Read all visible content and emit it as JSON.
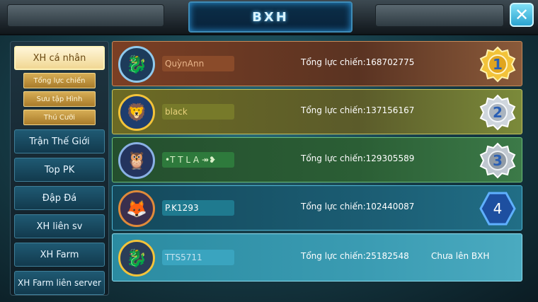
{
  "header": {
    "title": "BXH"
  },
  "sidebar": {
    "tabs": [
      {
        "label": "XH cá nhân",
        "active": true
      },
      {
        "label": "Trận Thế Giới"
      },
      {
        "label": "Top PK"
      },
      {
        "label": "Đập Đá"
      },
      {
        "label": "XH liên sv"
      },
      {
        "label": "XH Farm"
      },
      {
        "label": "XH Farm liên server"
      }
    ],
    "subtabs": [
      {
        "label": "Tổng lực chiến"
      },
      {
        "label": "Sưu tập Hình"
      },
      {
        "label": "Thú Cưỡi"
      }
    ]
  },
  "ranking": {
    "rows": [
      {
        "rank": "1",
        "name": "QuỳnAnn",
        "power": "Tổng lực chiến:168702775",
        "color": "#8a4b2a",
        "badge": "gold-medal-icon"
      },
      {
        "rank": "2",
        "name": "black",
        "power": "Tổng lực chiến:137156167",
        "color": "#6e6a1f",
        "badge": "silver-medal-icon"
      },
      {
        "rank": "3",
        "name": "•T T L A ↠❥",
        "power": "Tổng lực chiến:129305589",
        "color": "#2f6b3a",
        "badge": "bronze-medal-icon"
      },
      {
        "rank": "4",
        "name": "P.K1293",
        "power": "Tổng lực chiến:102440087",
        "color": "#1b6277",
        "badge": "hexagon-rank-icon"
      },
      {
        "rank": "",
        "name": "TTS5711",
        "power": "Tổng lực chiến:25182548",
        "status": "Chưa lên BXH",
        "color": "#2f8ea4"
      }
    ]
  }
}
